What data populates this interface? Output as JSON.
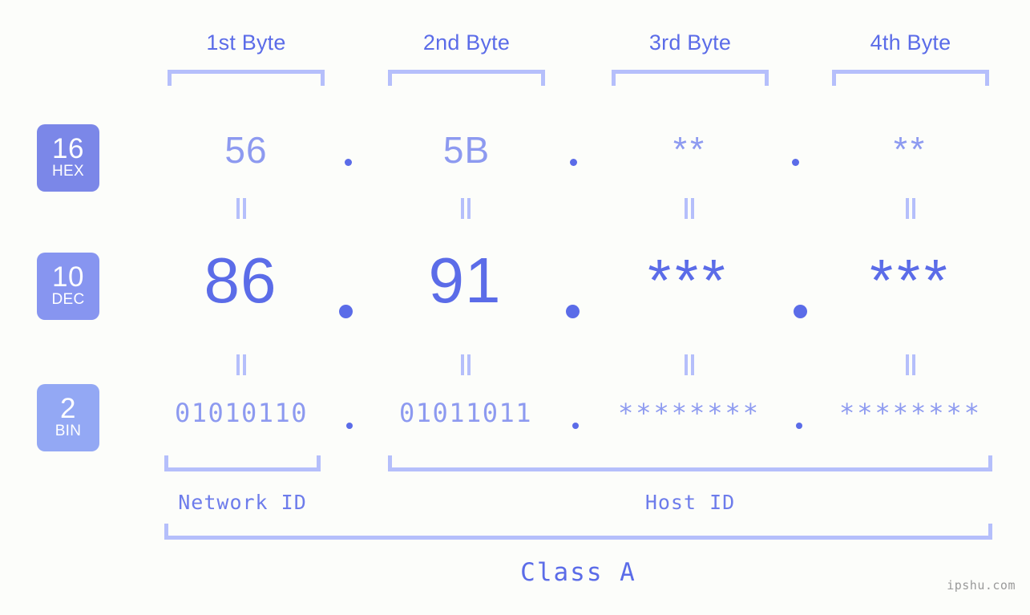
{
  "background_color": "#fcfdfa",
  "accent_colors": {
    "strong_blue": "#5b6ce8",
    "mid_blue": "#8d9af0",
    "light_blue": "#b5bffb",
    "badge_hex": "#7b87e8",
    "badge_dec": "#8795f0",
    "badge_bin": "#93a8f4",
    "watermark_gray": "#9a9a9a"
  },
  "byte_headers": [
    {
      "label": "1st Byte"
    },
    {
      "label": "2nd Byte"
    },
    {
      "label": "3rd Byte"
    },
    {
      "label": "4th Byte"
    }
  ],
  "rows": [
    {
      "badge_number": "16",
      "badge_name": "HEX",
      "values": [
        "56",
        "5B",
        "**",
        "**"
      ],
      "separators": [
        ".",
        ".",
        "."
      ]
    },
    {
      "badge_number": "10",
      "badge_name": "DEC",
      "values": [
        "86",
        "91",
        "***",
        "***"
      ],
      "separators": [
        ".",
        ".",
        "."
      ]
    },
    {
      "badge_number": "2",
      "badge_name": "BIN",
      "values": [
        "01010110",
        "01011011",
        "********",
        "********"
      ],
      "separators": [
        ".",
        ".",
        "."
      ]
    }
  ],
  "equals_glyph": "=",
  "sections": {
    "network_id": "Network ID",
    "host_id": "Host ID",
    "class": "Class A"
  },
  "watermark": "ipshu.com"
}
